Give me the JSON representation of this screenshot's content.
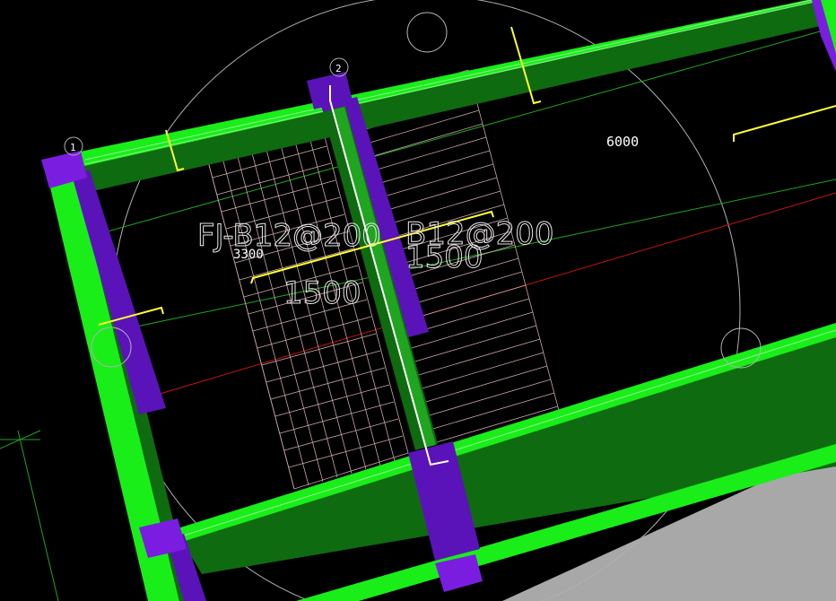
{
  "drawing": {
    "rebar_label_left": "FJ-B12@200",
    "rebar_label_right": "B12@200",
    "dim_3300": "3300",
    "dim_1500_left": "1500",
    "dim_1500_right": "1500",
    "dim_6000": "6000",
    "axis_1": "1",
    "axis_2": "2"
  },
  "colors": {
    "background": "#000000",
    "beam_green": "#0f6b0f",
    "beam_bright_green": "#19ee19",
    "column_purple": "#5a13b8",
    "column_violet": "#7a1de0",
    "grid_line_green": "#1fa51f",
    "axis_red": "#c81414",
    "dimension_yellow": "#ffff33",
    "rebar_white": "#ffffff",
    "hatch_pink": "#c9a8a8",
    "slab_gray": "#a8a8a8"
  }
}
